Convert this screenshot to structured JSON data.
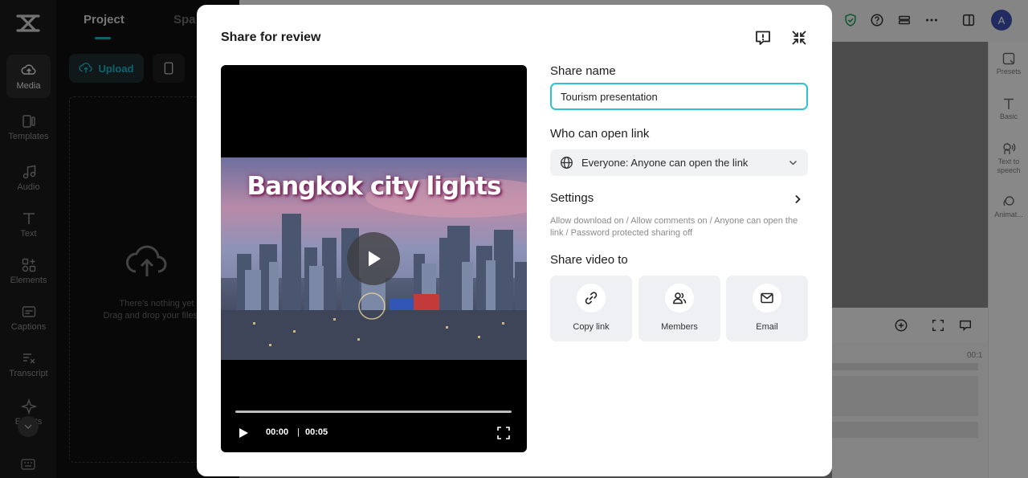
{
  "app": {
    "rail": [
      {
        "label": "Media",
        "icon": "media-icon",
        "active": true
      },
      {
        "label": "Templates",
        "icon": "templates-icon"
      },
      {
        "label": "Audio",
        "icon": "audio-icon"
      },
      {
        "label": "Text",
        "icon": "text-icon"
      },
      {
        "label": "Elements",
        "icon": "elements-icon"
      },
      {
        "label": "Captions",
        "icon": "captions-icon"
      },
      {
        "label": "Transcript",
        "icon": "transcript-icon"
      },
      {
        "label": "Effects",
        "icon": "effects-icon"
      }
    ],
    "panel": {
      "tab_project": "Project",
      "tab_spaces": "Spa",
      "upload_label": "Upload",
      "empty_line1": "There's nothing yet",
      "empty_line2": "Drag and drop your files he"
    },
    "right_rail": [
      {
        "label": "Presets",
        "icon": "presets-icon"
      },
      {
        "label": "Basic",
        "icon": "basic-text-icon"
      },
      {
        "label": "Text to speech",
        "icon": "text-to-speech-icon"
      },
      {
        "label": "Animat...",
        "icon": "animation-icon"
      }
    ],
    "timeline_time": "00:1",
    "avatar_initial": "A",
    "accent": "#1bb3c4"
  },
  "modal": {
    "title": "Share for review",
    "video": {
      "overlay_title": "Bangkok city lights",
      "current_time": "00:00",
      "separator": "|",
      "duration": "00:05",
      "progress": 0
    },
    "share_name_label": "Share name",
    "share_name_value": "Tourism presentation",
    "access_label": "Who can open link",
    "access_value": "Everyone: Anyone can open the link",
    "settings_label": "Settings",
    "settings_desc": "Allow download on / Allow comments on / Anyone can open the link / Password protected sharing off",
    "share_to_label": "Share video to",
    "share_options": [
      {
        "label": "Copy link",
        "icon": "link-icon"
      },
      {
        "label": "Members",
        "icon": "members-icon"
      },
      {
        "label": "Email",
        "icon": "email-icon"
      }
    ],
    "input_border_color": "#2fc2cf"
  }
}
